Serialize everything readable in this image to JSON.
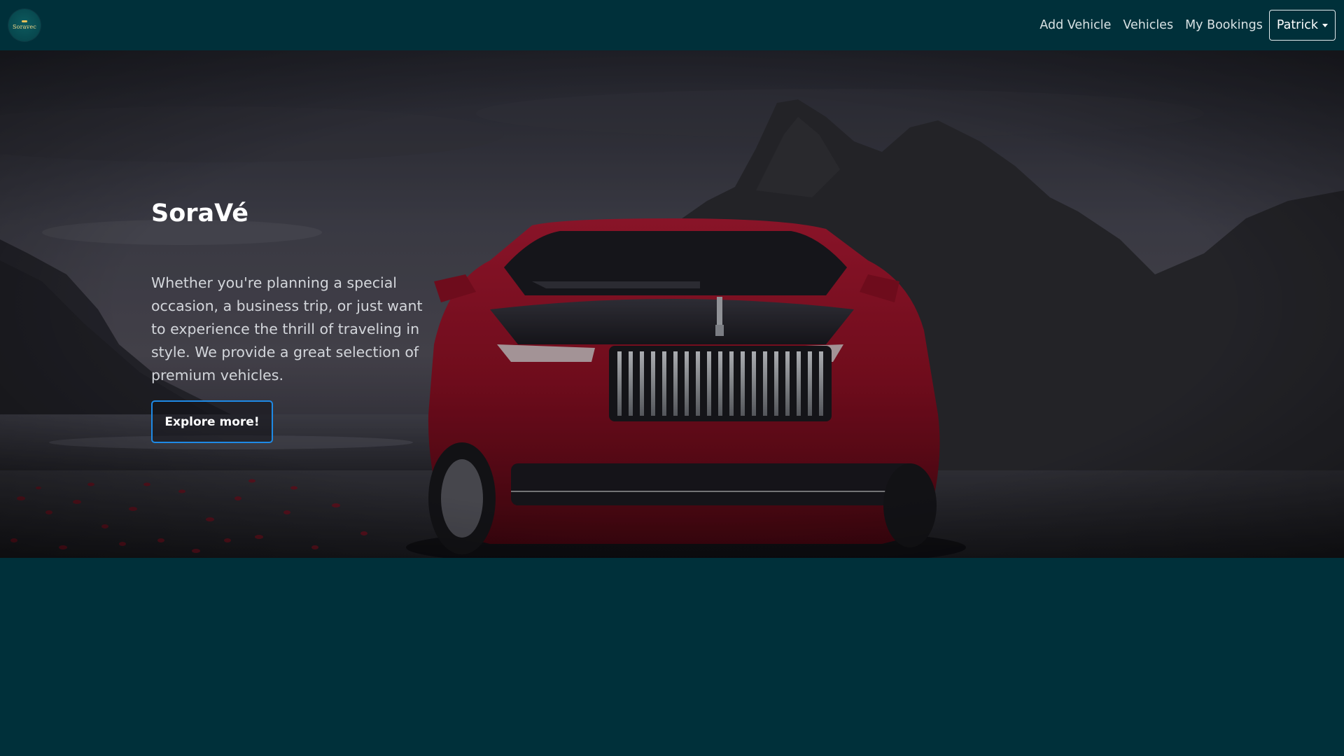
{
  "brand": {
    "logo_text": "Soravec"
  },
  "nav": {
    "items": [
      {
        "label": "Add Vehicle"
      },
      {
        "label": "Vehicles"
      },
      {
        "label": "My Bookings"
      }
    ],
    "user": {
      "name": "Patrick"
    }
  },
  "hero": {
    "title": "SoraVé",
    "text": "Whether you're planning a special occasion, a business trip, or just want to experience the thrill of traveling in style. We provide a great selection of premium vehicles.",
    "cta_label": "Explore more!"
  },
  "colors": {
    "page_bg": "#00303a",
    "cta_border": "#1e8ae6",
    "car_body": "#8e1024"
  }
}
